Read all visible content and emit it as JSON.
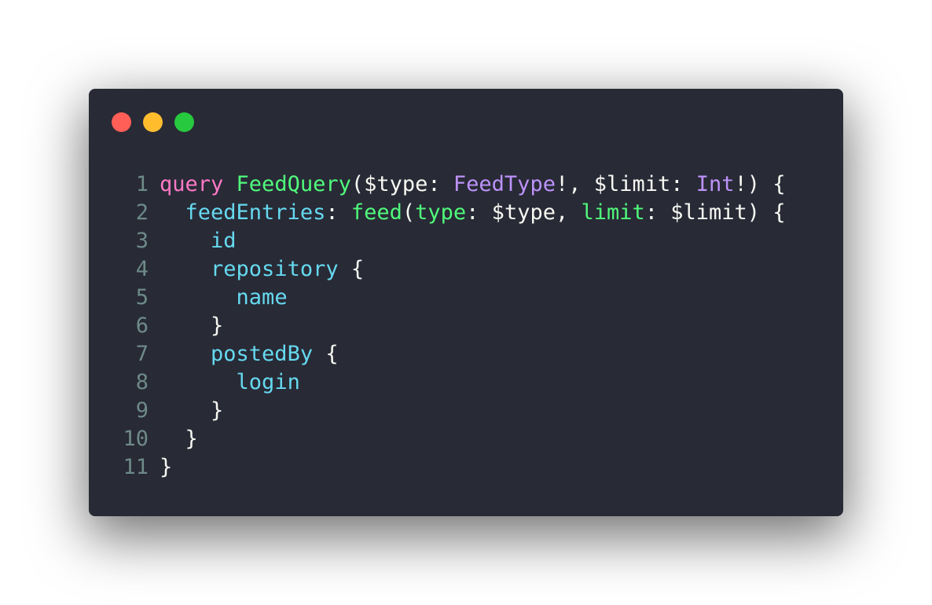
{
  "theme": {
    "background": "#282a36",
    "foreground": "#f8f8f2",
    "line_number": "#6d8a88",
    "keyword": "#ff79c6",
    "function": "#50fa7b",
    "type": "#bd93f9",
    "field": "#66d9ef"
  },
  "window_controls": [
    {
      "name": "close",
      "color": "#ff5f56"
    },
    {
      "name": "minimize",
      "color": "#ffbd2e"
    },
    {
      "name": "maximize",
      "color": "#27c93f"
    }
  ],
  "code": {
    "lines": [
      {
        "number": "1",
        "tokens": [
          {
            "text": "query",
            "kind": "keyword"
          },
          {
            "text": " ",
            "kind": "plain"
          },
          {
            "text": "FeedQuery",
            "kind": "function"
          },
          {
            "text": "($type: ",
            "kind": "plain"
          },
          {
            "text": "FeedType",
            "kind": "type"
          },
          {
            "text": "!, $limit: ",
            "kind": "plain"
          },
          {
            "text": "Int",
            "kind": "type"
          },
          {
            "text": "!) {",
            "kind": "plain"
          }
        ]
      },
      {
        "number": "2",
        "tokens": [
          {
            "text": "  ",
            "kind": "plain"
          },
          {
            "text": "feedEntries",
            "kind": "field"
          },
          {
            "text": ": ",
            "kind": "plain"
          },
          {
            "text": "feed",
            "kind": "function"
          },
          {
            "text": "(",
            "kind": "plain"
          },
          {
            "text": "type",
            "kind": "function"
          },
          {
            "text": ": $type, ",
            "kind": "plain"
          },
          {
            "text": "limit",
            "kind": "function"
          },
          {
            "text": ": $limit) {",
            "kind": "plain"
          }
        ]
      },
      {
        "number": "3",
        "tokens": [
          {
            "text": "    ",
            "kind": "plain"
          },
          {
            "text": "id",
            "kind": "field"
          }
        ]
      },
      {
        "number": "4",
        "tokens": [
          {
            "text": "    ",
            "kind": "plain"
          },
          {
            "text": "repository",
            "kind": "field"
          },
          {
            "text": " {",
            "kind": "plain"
          }
        ]
      },
      {
        "number": "5",
        "tokens": [
          {
            "text": "      ",
            "kind": "plain"
          },
          {
            "text": "name",
            "kind": "field"
          }
        ]
      },
      {
        "number": "6",
        "tokens": [
          {
            "text": "    }",
            "kind": "plain"
          }
        ]
      },
      {
        "number": "7",
        "tokens": [
          {
            "text": "    ",
            "kind": "plain"
          },
          {
            "text": "postedBy",
            "kind": "field"
          },
          {
            "text": " {",
            "kind": "plain"
          }
        ]
      },
      {
        "number": "8",
        "tokens": [
          {
            "text": "      ",
            "kind": "plain"
          },
          {
            "text": "login",
            "kind": "field"
          }
        ]
      },
      {
        "number": "9",
        "tokens": [
          {
            "text": "    }",
            "kind": "plain"
          }
        ]
      },
      {
        "number": "10",
        "tokens": [
          {
            "text": "  }",
            "kind": "plain"
          }
        ]
      },
      {
        "number": "11",
        "tokens": [
          {
            "text": "}",
            "kind": "plain"
          }
        ]
      }
    ]
  }
}
